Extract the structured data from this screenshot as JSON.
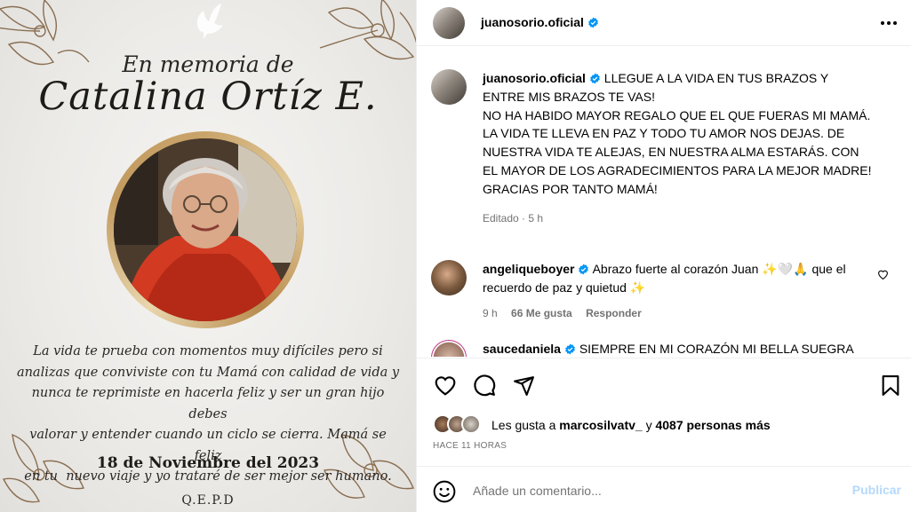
{
  "memorial": {
    "heading": "En memoria de",
    "name": "Catalina Ortíz E.",
    "message_lines": [
      "La vida te prueba con momentos muy difíciles pero si",
      "analizas que conviviste con tu Mamá con calidad de vida y",
      "nunca te reprimiste en hacerla feliz y ser un gran hijo debes",
      "valorar y entender cuando un ciclo se cierra. Mamá se feliz",
      "en tu  nuevo viaje y yo trataré de ser mejor ser humano."
    ],
    "date": "18 de Noviembre del 2023",
    "closing": "Q.E.P.D"
  },
  "header": {
    "username": "juanosorio.oficial",
    "more_icon": "more-horizontal-icon"
  },
  "caption": {
    "username": "juanosorio.oficial",
    "lines": [
      "LLEGUE A LA VIDA EN TUS BRAZOS Y ENTRE MIS BRAZOS TE VAS!",
      "NO HA HABIDO MAYOR REGALO QUE EL QUE FUERAS MI MAMÁ.",
      "LA VIDA TE LLEVA EN PAZ Y TODO TU AMOR NOS DEJAS. DE NUESTRA VIDA TE ALEJAS, EN NUESTRA ALMA ESTARÁS. CON EL MAYOR DE LOS AGRADECIMIENTOS PARA LA MEJOR MADRE! GRACIAS POR TANTO MAMÁ!"
    ],
    "edited": "Editado",
    "time": "5 h"
  },
  "comments": [
    {
      "username": "angeliqueboyer",
      "text": "Abrazo fuerte al corazón Juan ✨🤍🙏 que el recuerdo de paz y quietud ✨",
      "time": "9 h",
      "likes": "66 Me gusta",
      "reply": "Responder"
    },
    {
      "username": "saucedaniela",
      "text": "SIEMPRE EN MI CORAZÓN MI BELLA SUEGRA"
    }
  ],
  "likes": {
    "prefix": "Les gusta a",
    "user": "marcosilvatv_",
    "joiner": "y",
    "others": "4087 personas más"
  },
  "posted": "HACE 11 HORAS",
  "add_comment": {
    "placeholder": "Añade un comentario...",
    "publish": "Publicar"
  },
  "colors": {
    "verified": "#0095f6",
    "publish_disabled": "#b4d9fb",
    "muted_text": "#737373"
  }
}
